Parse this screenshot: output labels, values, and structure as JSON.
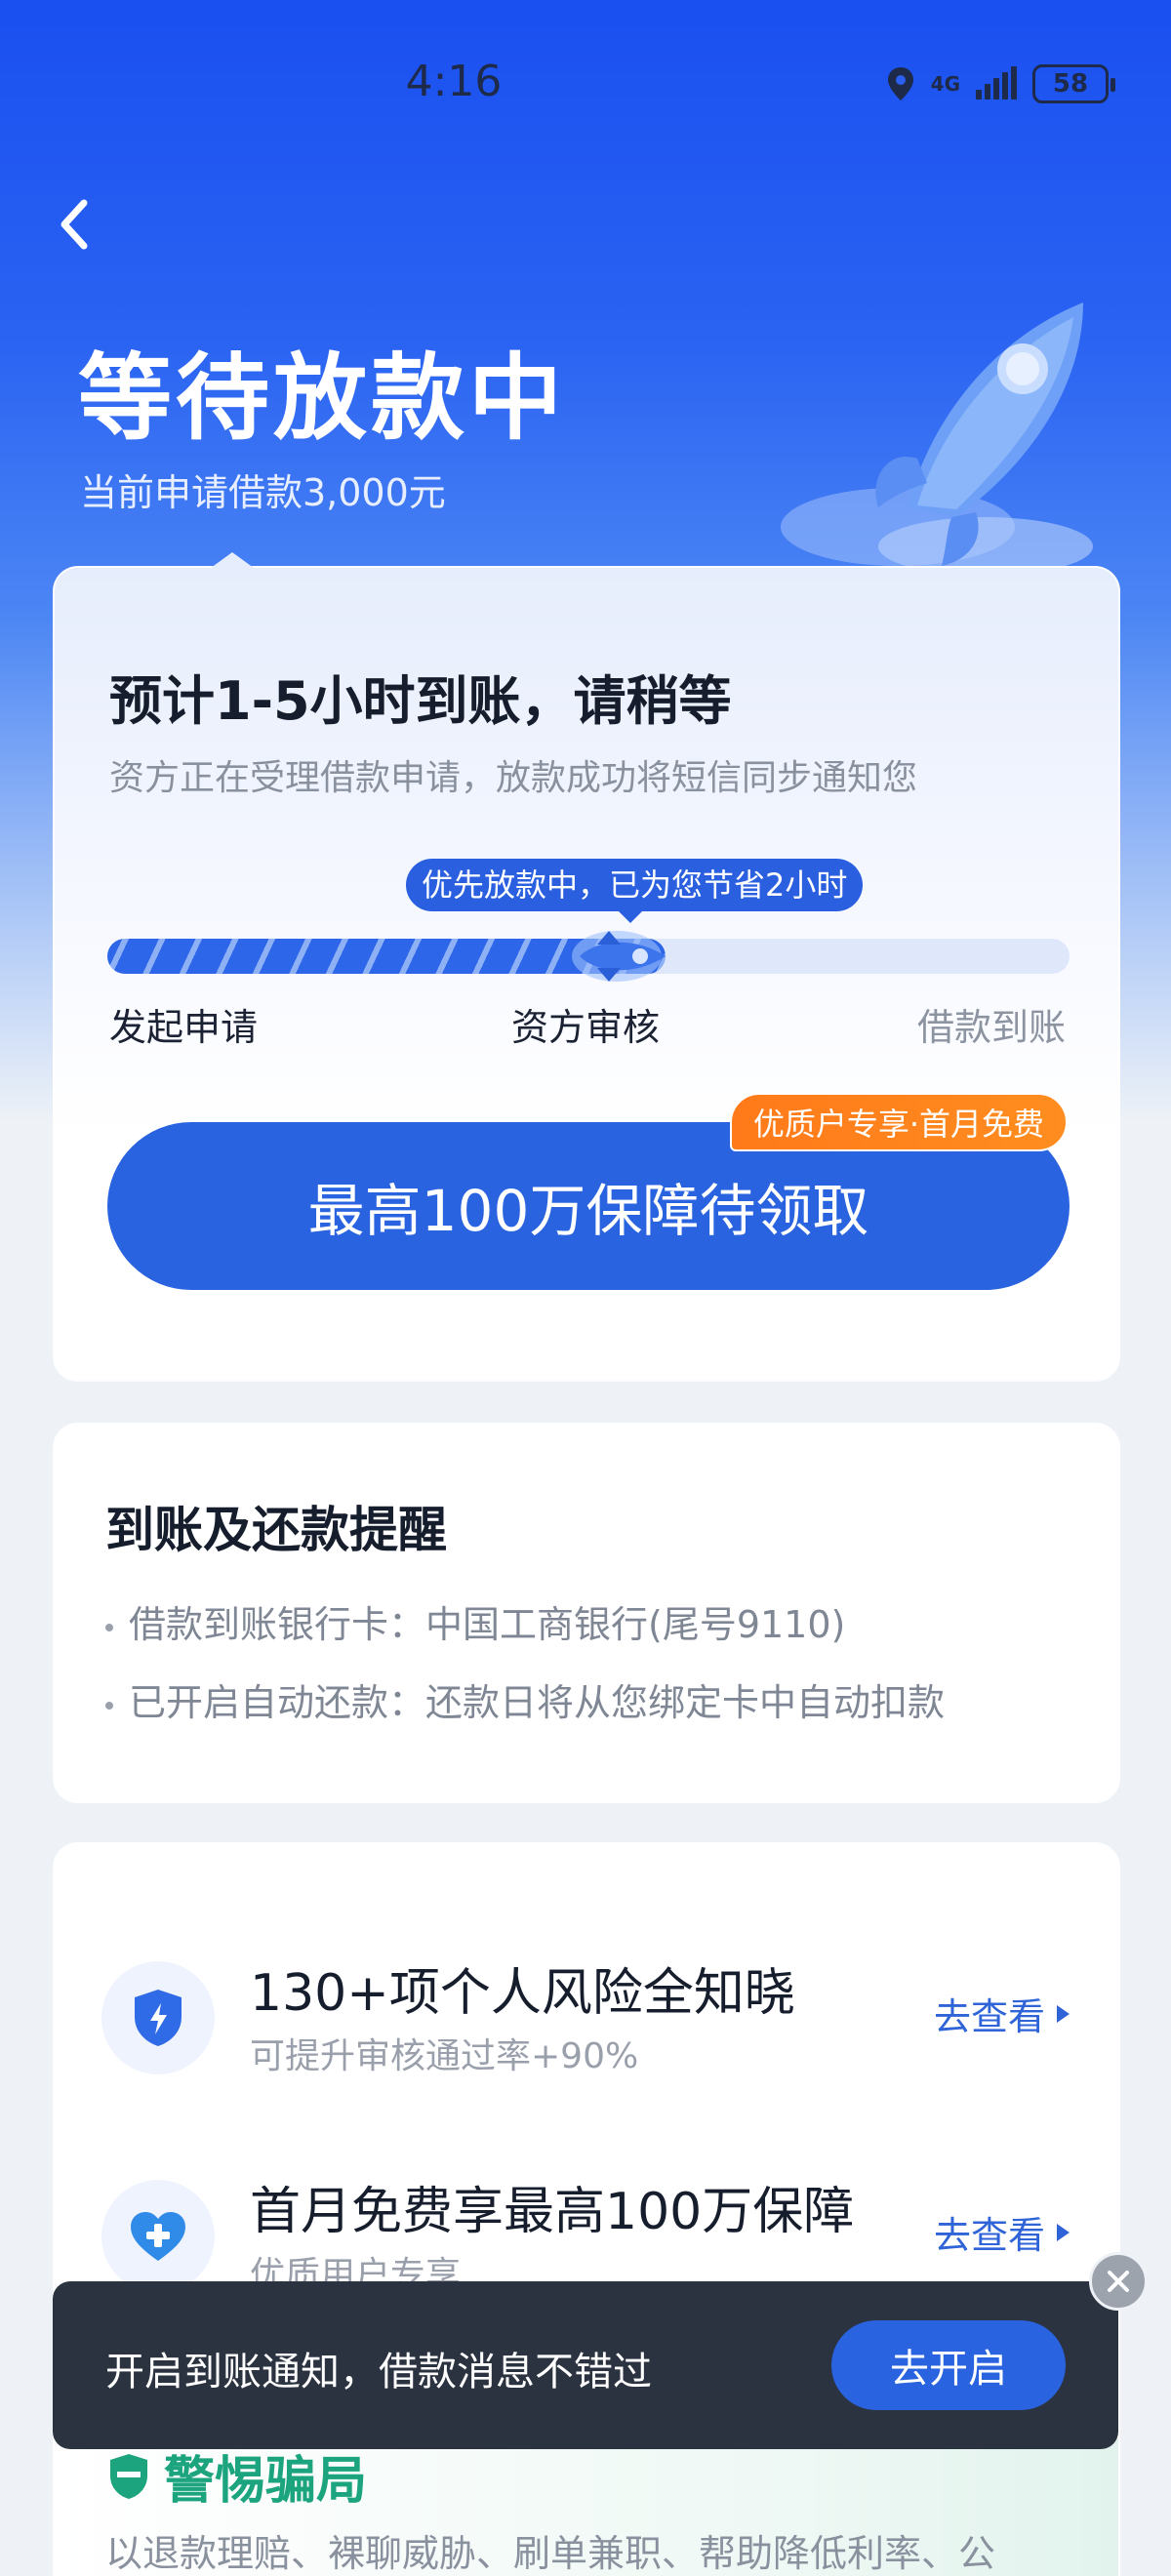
{
  "status_bar": {
    "time": "4:16",
    "network": "4G",
    "battery": "58"
  },
  "header": {
    "title": "等待放款中",
    "subtitle": "当前申请借款3,000元"
  },
  "main_card": {
    "title": "预计1-5小时到账，请稍等",
    "description": "资方正在受理借款申请，放款成功将短信同步通知您",
    "tip": "优先放款中，已为您节省2小时",
    "progress": 0.58,
    "steps": [
      "发起申请",
      "资方审核",
      "借款到账"
    ],
    "promo_button": "最高100万保障待领取",
    "promo_badge": "优质户专享·首月免费"
  },
  "reminder_card": {
    "title": "到账及还款提醒",
    "lines": [
      "借款到账银行卡：中国工商银行(尾号9110)",
      "已开启自动还款：还款日将从您绑定卡中自动扣款"
    ]
  },
  "services": [
    {
      "title": "130+项个人风险全知晓",
      "subtitle": "可提升审核通过率+90%",
      "link": "去查看",
      "icon": "shield-bolt-icon"
    },
    {
      "title": "首月免费享最高100万保障",
      "subtitle": "优质用户专享",
      "link": "去查看",
      "icon": "heart-plus-icon"
    }
  ],
  "toast": {
    "text": "开启到账通知，借款消息不错过",
    "button": "去开启"
  },
  "fraud": {
    "title": "警惕骗局",
    "description": "以退款理赔、裸聊威胁、刷单兼职、帮助降低利率、公"
  },
  "colors": {
    "primary": "#2963e0",
    "badge_orange": "#ff7a1a",
    "fraud_green": "#1ba47e"
  }
}
